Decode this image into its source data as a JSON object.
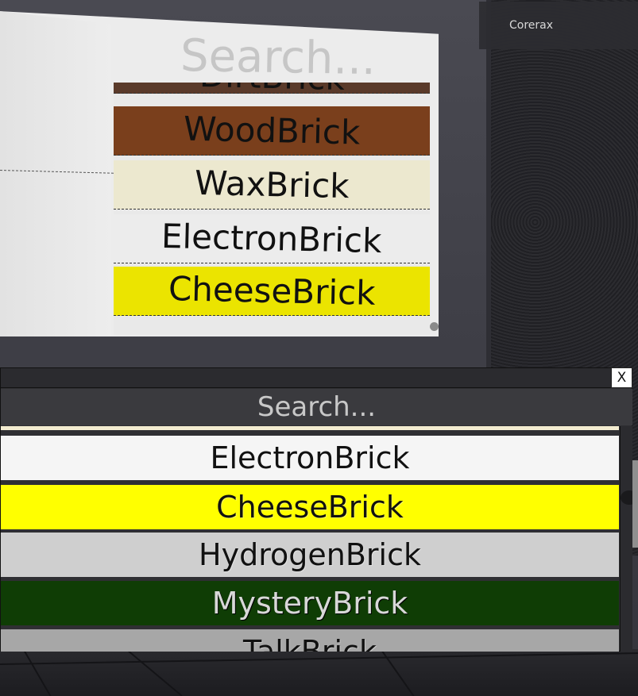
{
  "player": {
    "name": "Corerax"
  },
  "world_board": {
    "search_placeholder": "Search...",
    "items": [
      {
        "label": "DirtBrick",
        "color": "#5a3a2a"
      },
      {
        "label": "WoodBrick",
        "color": "#7a3f1c"
      },
      {
        "label": "WaxBrick",
        "color": "#ece8cf"
      },
      {
        "label": "ElectronBrick",
        "color": "#ececec"
      },
      {
        "label": "CheeseBrick",
        "color": "#ebe400"
      }
    ]
  },
  "gui": {
    "close_label": "X",
    "search_placeholder": "Search...",
    "items": [
      {
        "label": "ElectronBrick",
        "color": "#f5f5f5"
      },
      {
        "label": "CheeseBrick",
        "color": "#ffff00"
      },
      {
        "label": "HydrogenBrick",
        "color": "#cfcfcf"
      },
      {
        "label": "MysteryBrick",
        "color": "#0f3d05"
      },
      {
        "label": "TalkBrick",
        "color": "#a7a7a7"
      }
    ]
  }
}
